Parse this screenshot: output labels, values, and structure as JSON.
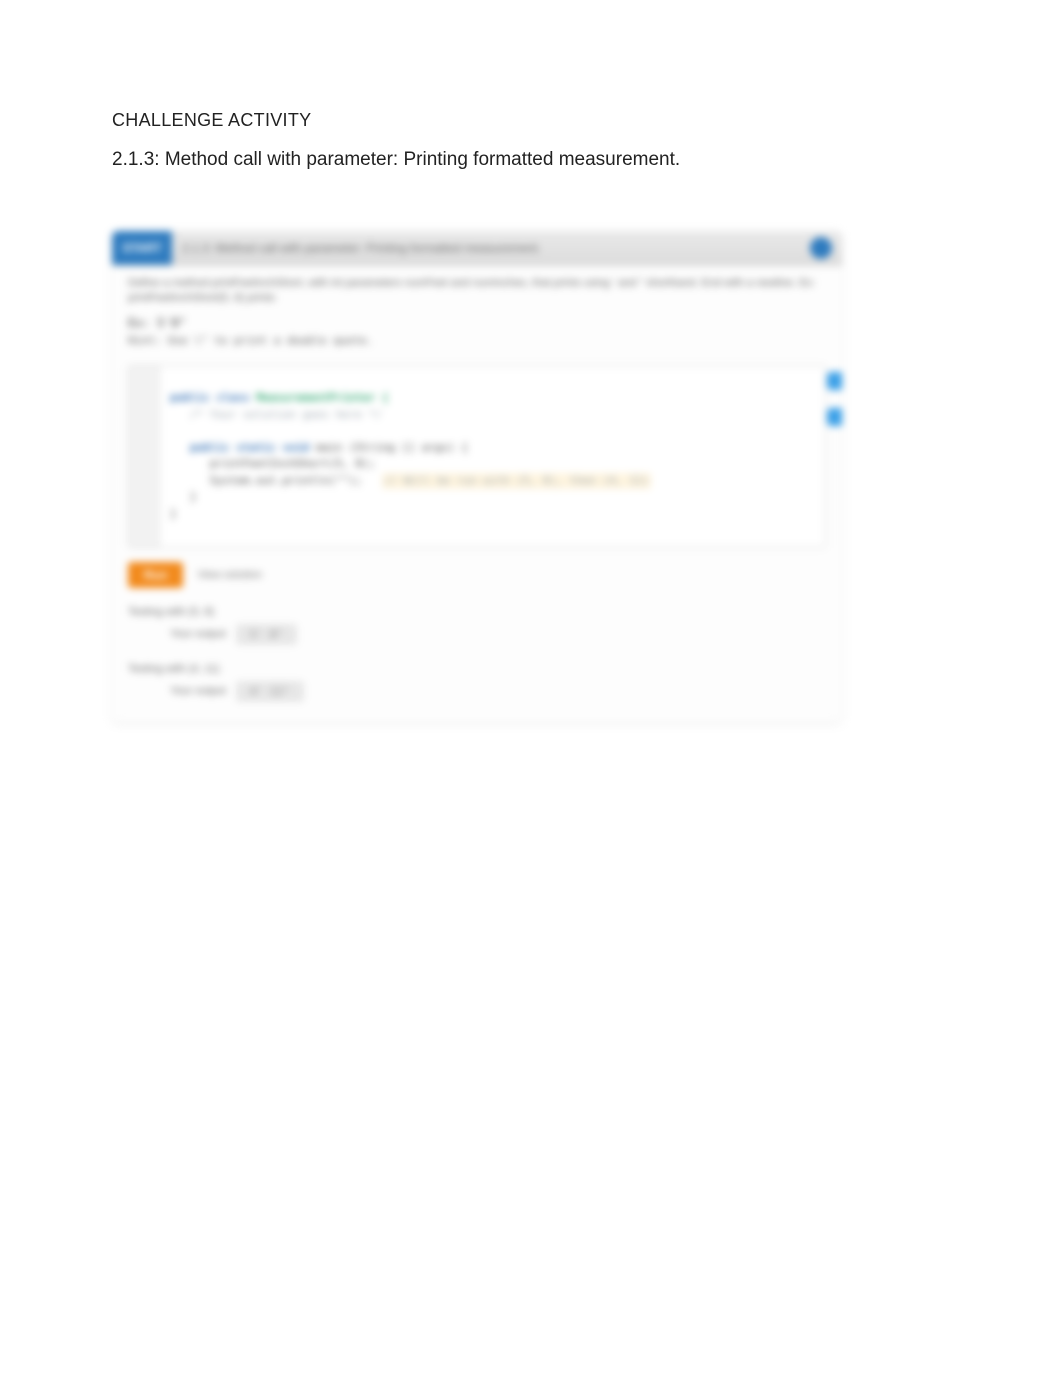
{
  "eyebrow": "CHALLENGE ACTIVITY",
  "title": "2.1.3: Method call with parameter: Printing formatted measurement.",
  "card": {
    "badge": "START",
    "header_title": "2.1.3: Method call with parameter: Printing formatted measurement.",
    "instruction": "Define a method printFeetInchShort, with int parameters numFeet and numInches, that prints using ' and \" shorthand. End with a newline. Ex: printFeetInchShort(5, 8) prints:",
    "ex_label": "Ex: 5'8\"",
    "sample": "Hint: Use \\\" to print a double quote.",
    "code": {
      "l1_a": "public",
      "l1_b": "class",
      "l1_c": "MeasurementPrinter {",
      "l2": "   /* Your solution goes here */",
      "l3_a": "   public static void",
      "l3_b": "main (String [] args) {",
      "l4": "      printFeetInchShort(5, 8);",
      "l5": "      System.out.println(\"\");",
      "l6": "   }",
      "l7": "}",
      "hl_comment": "// Will be run with (5, 8), then (4, 11)"
    },
    "run": {
      "button": "Run",
      "hint": "View solution"
    },
    "tests": [
      {
        "label": "Testing with (5, 8)",
        "caption": "Your output",
        "box": "5' 8\""
      },
      {
        "label": "Testing with (4, 11)",
        "caption": "Your output",
        "box": "4' 11\""
      }
    ]
  }
}
